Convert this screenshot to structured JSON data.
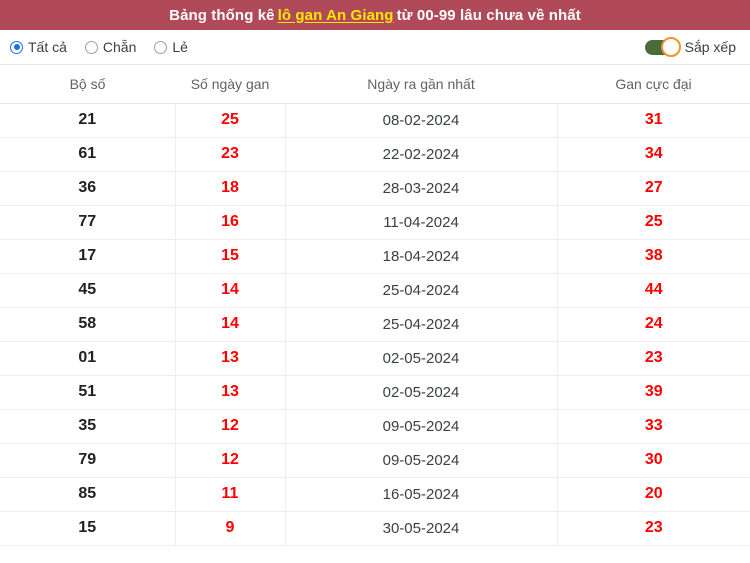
{
  "header": {
    "title_prefix": "Bảng thống kê",
    "title_link": "lô gan An Giang",
    "title_suffix": "từ 00-99 lâu chưa về nhất",
    "bg_color": "#b04a59",
    "link_color": "#ffe600"
  },
  "controls": {
    "radios": [
      {
        "label": "Tất cả",
        "selected": true
      },
      {
        "label": "Chẵn",
        "selected": false
      },
      {
        "label": "Lẻ",
        "selected": false
      }
    ],
    "toggle": {
      "label": "Sắp xếp",
      "state": "on",
      "track_color": "#4a6b3a",
      "knob_ring_color": "#f0932b"
    }
  },
  "table": {
    "columns": [
      "Bộ số",
      "Số ngày gan",
      "Ngày ra gần nhất",
      "Gan cực đại"
    ],
    "accent_color": "#ff0000",
    "rows": [
      {
        "bo_so": "21",
        "so_ngay_gan": "25",
        "ngay_ra_gan_nhat": "08-02-2024",
        "gan_cuc_dai": "31"
      },
      {
        "bo_so": "61",
        "so_ngay_gan": "23",
        "ngay_ra_gan_nhat": "22-02-2024",
        "gan_cuc_dai": "34"
      },
      {
        "bo_so": "36",
        "so_ngay_gan": "18",
        "ngay_ra_gan_nhat": "28-03-2024",
        "gan_cuc_dai": "27"
      },
      {
        "bo_so": "77",
        "so_ngay_gan": "16",
        "ngay_ra_gan_nhat": "11-04-2024",
        "gan_cuc_dai": "25"
      },
      {
        "bo_so": "17",
        "so_ngay_gan": "15",
        "ngay_ra_gan_nhat": "18-04-2024",
        "gan_cuc_dai": "38"
      },
      {
        "bo_so": "45",
        "so_ngay_gan": "14",
        "ngay_ra_gan_nhat": "25-04-2024",
        "gan_cuc_dai": "44"
      },
      {
        "bo_so": "58",
        "so_ngay_gan": "14",
        "ngay_ra_gan_nhat": "25-04-2024",
        "gan_cuc_dai": "24"
      },
      {
        "bo_so": "01",
        "so_ngay_gan": "13",
        "ngay_ra_gan_nhat": "02-05-2024",
        "gan_cuc_dai": "23"
      },
      {
        "bo_so": "51",
        "so_ngay_gan": "13",
        "ngay_ra_gan_nhat": "02-05-2024",
        "gan_cuc_dai": "39"
      },
      {
        "bo_so": "35",
        "so_ngay_gan": "12",
        "ngay_ra_gan_nhat": "09-05-2024",
        "gan_cuc_dai": "33"
      },
      {
        "bo_so": "79",
        "so_ngay_gan": "12",
        "ngay_ra_gan_nhat": "09-05-2024",
        "gan_cuc_dai": "30"
      },
      {
        "bo_so": "85",
        "so_ngay_gan": "11",
        "ngay_ra_gan_nhat": "16-05-2024",
        "gan_cuc_dai": "20"
      },
      {
        "bo_so": "15",
        "so_ngay_gan": "9",
        "ngay_ra_gan_nhat": "30-05-2024",
        "gan_cuc_dai": "23"
      }
    ]
  }
}
